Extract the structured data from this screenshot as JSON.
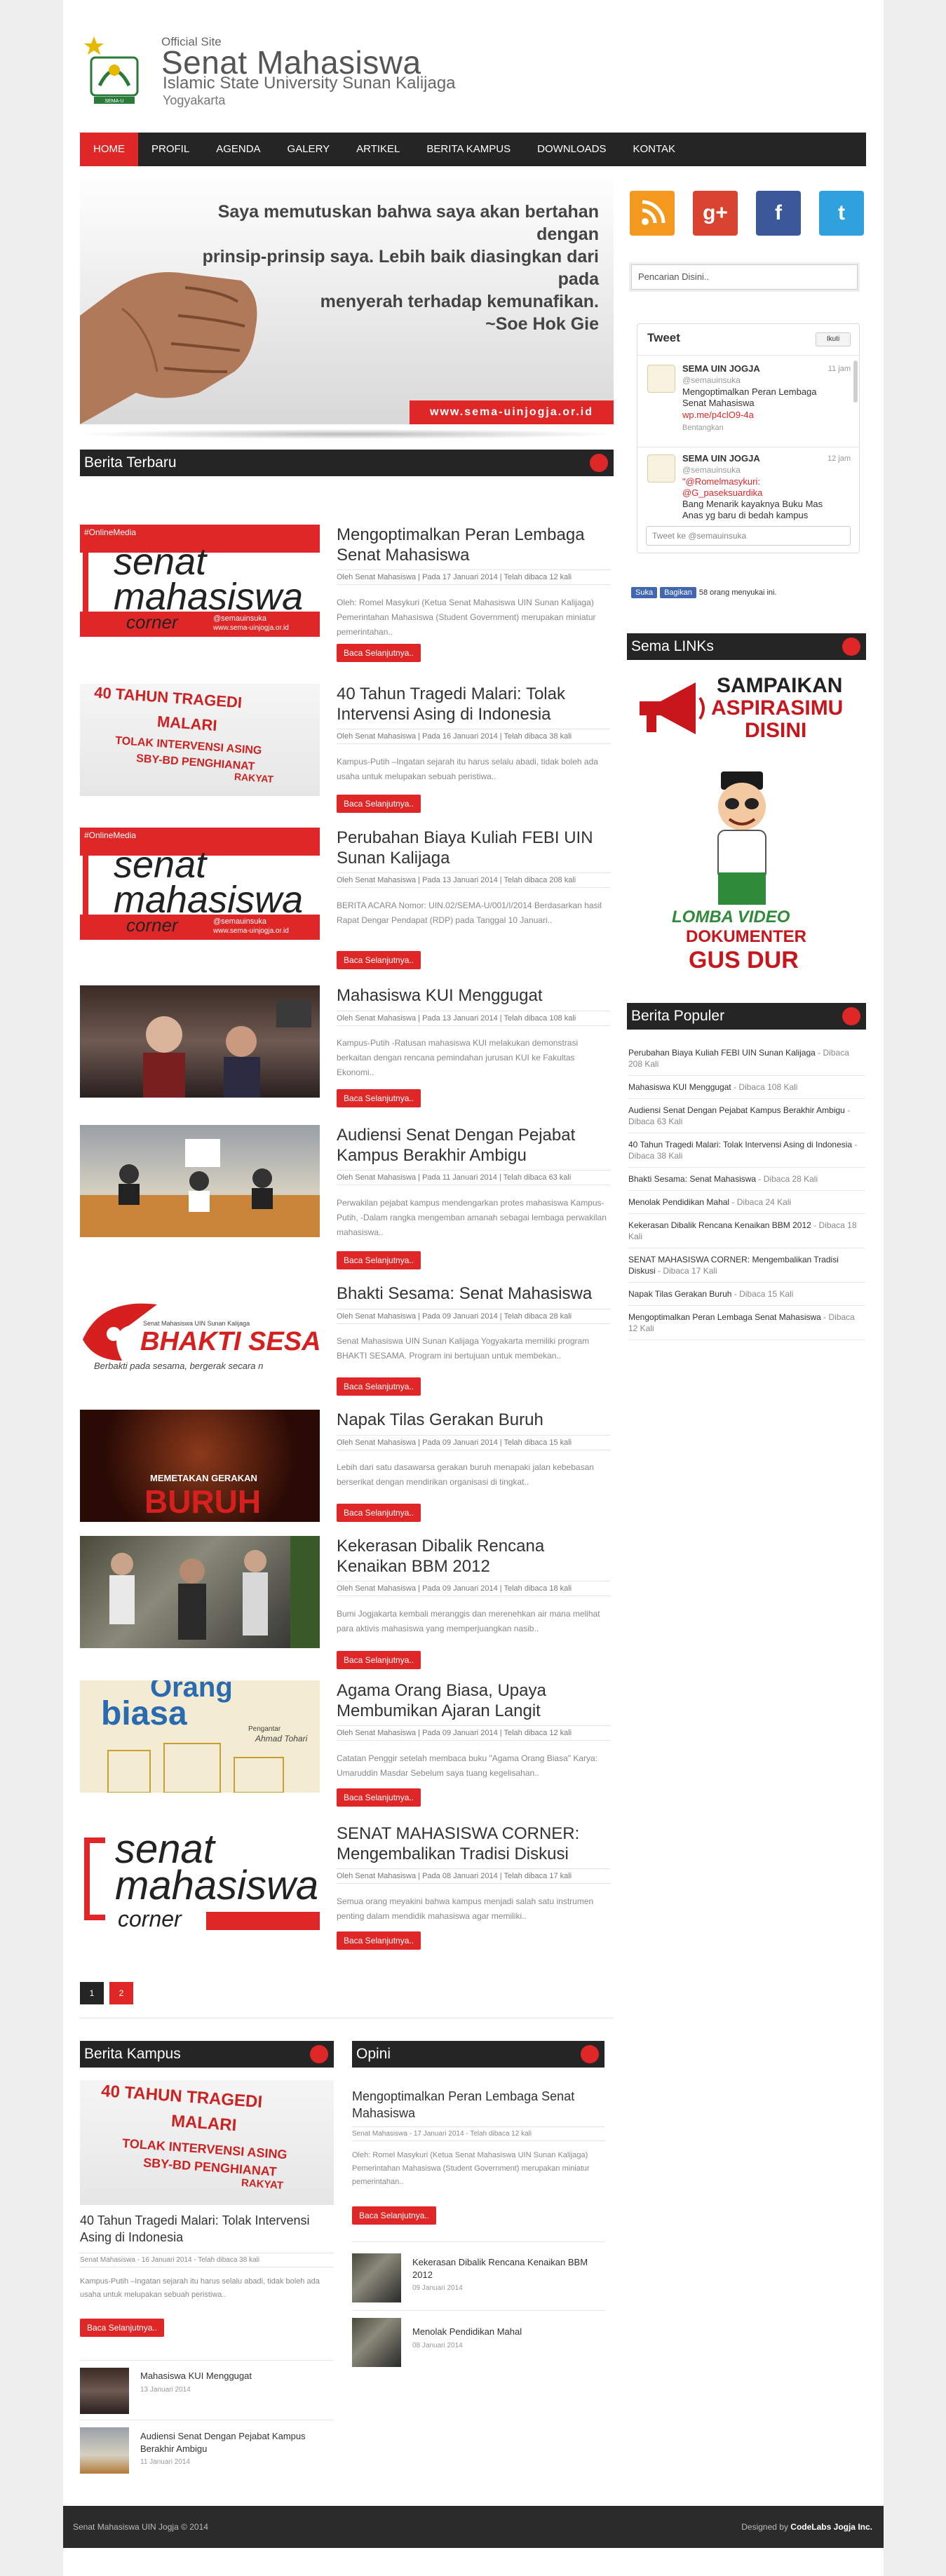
{
  "header": {
    "official": "Official Site",
    "title": "Senat Mahasiswa",
    "subtitle": "Islamic State University Sunan Kalijaga",
    "city": "Yogyakarta",
    "logo_text": "SEMA-U"
  },
  "nav": {
    "items": [
      "HOME",
      "PROFIL",
      "AGENDA",
      "GALERY",
      "ARTIKEL",
      "BERITA KAMPUS",
      "DOWNLOADS",
      "KONTAK"
    ]
  },
  "banner": {
    "quote_1": "Saya memutuskan bahwa saya akan bertahan dengan",
    "quote_2": "prinsip-prinsip saya. Lebih baik diasingkan dari pada",
    "quote_3": "menyerah terhadap kemunafikan.",
    "author": "~Soe Hok Gie",
    "url": "www.sema-uinjogja.or.id"
  },
  "berita_terbaru": {
    "heading": "Berita Terbaru",
    "read_more": "Baca Selanjutnya..",
    "articles": [
      {
        "title": "Mengoptimalkan Peran Lembaga Senat Mahasiswa",
        "meta": "Oleh Senat Mahasiswa | Pada 17 Januari 2014 | Telah dibaca 12 kali",
        "excerpt": "Oleh: Romel Masykuri (Ketua Senat Mahasiswa UIN Sunan Kalijaga) Pemerintahan Mahasiswa (Student Government) merupakan miniatur pemerintahan..",
        "thumb_text_1": "senat",
        "thumb_text_2": "mahasiswa",
        "thumb_text_3": "corner",
        "thumb_tag": "#OnlineMedia",
        "thumb_handle": "@semauinsuka",
        "thumb_url": "www.sema-uinjogja.or.id"
      },
      {
        "title": "40 Tahun Tragedi Malari: Tolak Intervensi Asing di Indonesia",
        "meta": "Oleh Senat Mahasiswa | Pada 16 Januari 2014 | Telah dibaca 38 kali",
        "excerpt": "Kampus-Putih –Ingatan sejarah itu harus selalu abadi, tidak boleh ada usaha untuk melupakan sebuah peristiwa..",
        "banner_1": "40 TAHUN TRAGEDI",
        "banner_2": "MALARI",
        "banner_3": "TOLAK INTERVENSI ASING",
        "banner_4": "SBY-BD PENGHIANAT",
        "banner_5": "RAKYAT"
      },
      {
        "title": "Perubahan Biaya Kuliah FEBI UIN Sunan Kalijaga",
        "meta": "Oleh Senat Mahasiswa | Pada 13 Januari 2014 | Telah dibaca 208 kali",
        "excerpt": "BERITA ACARA Nomor: UIN.02/SEMA-U/001/I/2014 Berdasarkan hasil Rapat Dengar Pendapat (RDP) pada Tanggal 10 Januari..",
        "thumb_text_1": "senat",
        "thumb_text_2": "mahasiswa",
        "thumb_text_3": "corner",
        "thumb_tag": "#OnlineMedia",
        "thumb_handle": "@semauinsuka",
        "thumb_url": "www.sema-uinjogja.or.id"
      },
      {
        "title": "Mahasiswa KUI Menggugat",
        "meta": "Oleh Senat Mahasiswa | Pada 13 Januari 2014 | Telah dibaca 108 kali",
        "excerpt": "Kampus-Putih -Ratusan mahasiswa KUI melakukan demonstrasi berkaitan dengan rencana pemindahan jurusan KUI ke Fakultas Ekonomi.."
      },
      {
        "title": "Audiensi Senat Dengan Pejabat Kampus Berakhir Ambigu",
        "meta": "Oleh Senat Mahasiswa | Pada 11 Januari 2014 | Telah dibaca 63 kali",
        "excerpt": "Perwakilan pejabat kampus mendengarkan protes mahasiswa Kampus-Putih, -Dalam rangka mengemban amanah sebagai lembaga perwakilan mahasiswa.."
      },
      {
        "title": "Bhakti Sesama: Senat Mahasiswa",
        "meta": "Oleh Senat Mahasiswa | Pada 09 Januari 2014 | Telah dibaca 28 kali",
        "excerpt": "Senat Mahasiswa UIN Sunan Kalijaga Yogyakarta memiliki program BHAKTI SESAMA. Program ini bertujuan untuk membekan..",
        "thumb_small": "Senat Mahasiswa UIN Sunan Kalijaga",
        "thumb_big": "BHAKTI SESAMA",
        "thumb_tagline": "Berbakti pada sesama, bergerak secara n"
      },
      {
        "title": "Napak Tilas Gerakan Buruh",
        "meta": "Oleh Senat Mahasiswa | Pada 09 Januari 2014 | Telah dibaca 15 kali",
        "excerpt": "Lebih dari satu dasawarsa gerakan buruh menapaki jalan kebebasan berserikat dengan mendirikan organisasi di tingkat..",
        "thumb_small": "MEMETAKAN GERAKAN",
        "thumb_big": "BURUH"
      },
      {
        "title": "Kekerasan Dibalik Rencana Kenaikan BBM 2012",
        "meta": "Oleh Senat Mahasiswa | Pada 09 Januari 2014 | Telah dibaca 18 kali",
        "excerpt": "Bumi Jogjakarta kembali meranggis dan merenehkan air mana melihat para aktivis mahasiswa yang memperjuangkan nasib.."
      },
      {
        "title": "Agama Orang Biasa, Upaya Membumikan Ajaran Langit",
        "meta": "Oleh Senat Mahasiswa | Pada 09 Januari 2014 | Telah dibaca 12 kali",
        "excerpt": "Catatan Penggir setelah membaca buku \"Agama Orang Biasa\" Karya: Umaruddin Masdar Sebelum saya tuang kegelisahan..",
        "thumb_big": "Orang",
        "thumb_big2": "biasa",
        "thumb_small": "Pengantar",
        "thumb_author": "Ahmad Tohari"
      },
      {
        "title": "SENAT MAHASISWA CORNER: Mengembalikan Tradisi Diskusi",
        "meta": "Oleh Senat Mahasiswa | Pada 08 Januari 2014 | Telah dibaca 17 kali",
        "excerpt": "Semua orang meyakini bahwa kampus menjadi salah satu instrumen penting dalam mendidik mahasiswa agar memiliki..",
        "thumb_text_1": "senat",
        "thumb_text_2": "mahasiswa",
        "thumb_text_3": "corner"
      }
    ]
  },
  "pagination": [
    "1",
    "2"
  ],
  "sidebar": {
    "social": [
      "rss",
      "g+",
      "f",
      "t"
    ],
    "search_placeholder": "Pencarian Disini..",
    "twitter": {
      "heading": "Tweet",
      "follow": "Ikuti",
      "tweets": [
        {
          "name": "SEMA UIN JOGJA",
          "handle": "@semauinsuka",
          "time": "11 jam",
          "text": "Mengoptimalkan Peran Lembaga Senat Mahasiswa",
          "link": "wp.me/p4clO9-4a",
          "sub": "Bentangkan"
        },
        {
          "name": "SEMA UIN JOGJA",
          "handle": "@semauinsuka",
          "time": "12 jam",
          "text_link": "\"@Romelmasykuri: @G_paseksuardika",
          "text": "Bang Menarik kayaknya Buku Mas Anas yg baru di bedah kampus"
        }
      ],
      "reply_placeholder": "Tweet ke @semauinsuka"
    },
    "fb": {
      "suka": "Suka",
      "bagikan": "Bagikan",
      "count": "58 orang menyukai ini."
    },
    "links_heading": "Sema LINKs",
    "promo1_line1": "SAMPAIKAN",
    "promo1_line2": "ASPIRASIMU",
    "promo1_line3": "DISINI",
    "promo2_line1": "LOMBA VIDEO",
    "promo2_line2": "DOKUMENTER",
    "promo2_line3": "GUS DUR",
    "populer_heading": "Berita Populer",
    "populer": [
      {
        "title": "Perubahan Biaya Kuliah FEBI UIN Sunan Kalijaga",
        "count": " - Dibaca 208 Kali"
      },
      {
        "title": "Mahasiswa KUI Menggugat",
        "count": " - Dibaca 108 Kali"
      },
      {
        "title": "Audiensi Senat Dengan Pejabat Kampus Berakhir Ambigu",
        "count": " - Dibaca 63 Kali"
      },
      {
        "title": "40 Tahun Tragedi Malari: Tolak Intervensi Asing di Indonesia",
        "count": " - Dibaca 38 Kali"
      },
      {
        "title": "Bhakti Sesama: Senat Mahasiswa",
        "count": " - Dibaca 28 Kali"
      },
      {
        "title": "Menolak Pendidikan Mahal",
        "count": " - Dibaca 24 Kali"
      },
      {
        "title": "Kekerasan Dibalik Rencana Kenaikan BBM 2012",
        "count": " - Dibaca 18 Kali"
      },
      {
        "title": "SENAT MAHASISWA CORNER: Mengembalikan Tradisi Diskusi",
        "count": " - Dibaca 17 Kali"
      },
      {
        "title": "Napak Tilas Gerakan Buruh",
        "count": " - Dibaca 15 Kali"
      },
      {
        "title": "Mengoptimalkan Peran Lembaga Senat Mahasiswa",
        "count": " - Dibaca 12 Kali"
      }
    ]
  },
  "berita_kampus": {
    "heading": "Berita Kampus",
    "main_title": "40 Tahun Tragedi Malari: Tolak Intervensi Asing di Indonesia",
    "main_meta": "Senat Mahasiswa - 16 Januari 2014 - Telah dibaca 38 kali",
    "main_excerpt": "Kampus-Putih –Ingatan sejarah itu harus selalu abadi, tidak boleh ada usaha untuk melupakan sebuah peristiwa..",
    "read_more": "Baca Selanjutnya..",
    "items": [
      {
        "title": "Mahasiswa KUI Menggugat",
        "date": "13 Januari 2014"
      },
      {
        "title": "Audiensi Senat Dengan Pejabat Kampus Berakhir Ambigu",
        "date": "11 Januari 2014"
      }
    ]
  },
  "opini": {
    "heading": "Opini",
    "main_title": "Mengoptimalkan Peran Lembaga Senat Mahasiswa",
    "main_meta": "Senat Mahasiswa - 17 Januari 2014 - Telah dibaca 12 kali",
    "main_excerpt": "Oleh: Romel Masykuri (Ketua Senat Mahasiswa UIN Sunan Kalijaga) Pemerintahan Mahasiswa (Student Government) merupakan miniatur pemerintahan..",
    "read_more": "Baca Selanjutnya..",
    "items": [
      {
        "title": "Kekerasan Dibalik Rencana Kenaikan BBM 2012",
        "date": "09 Januari 2014"
      },
      {
        "title": "Menolak Pendidikan Mahal",
        "date": "08 Januari 2014"
      }
    ]
  },
  "footer": {
    "left": "Senat Mahasiswa UIN Jogja  © 2014",
    "right_prefix": "Designed by ",
    "right_brand": "CodeLabs Jogja Inc."
  }
}
